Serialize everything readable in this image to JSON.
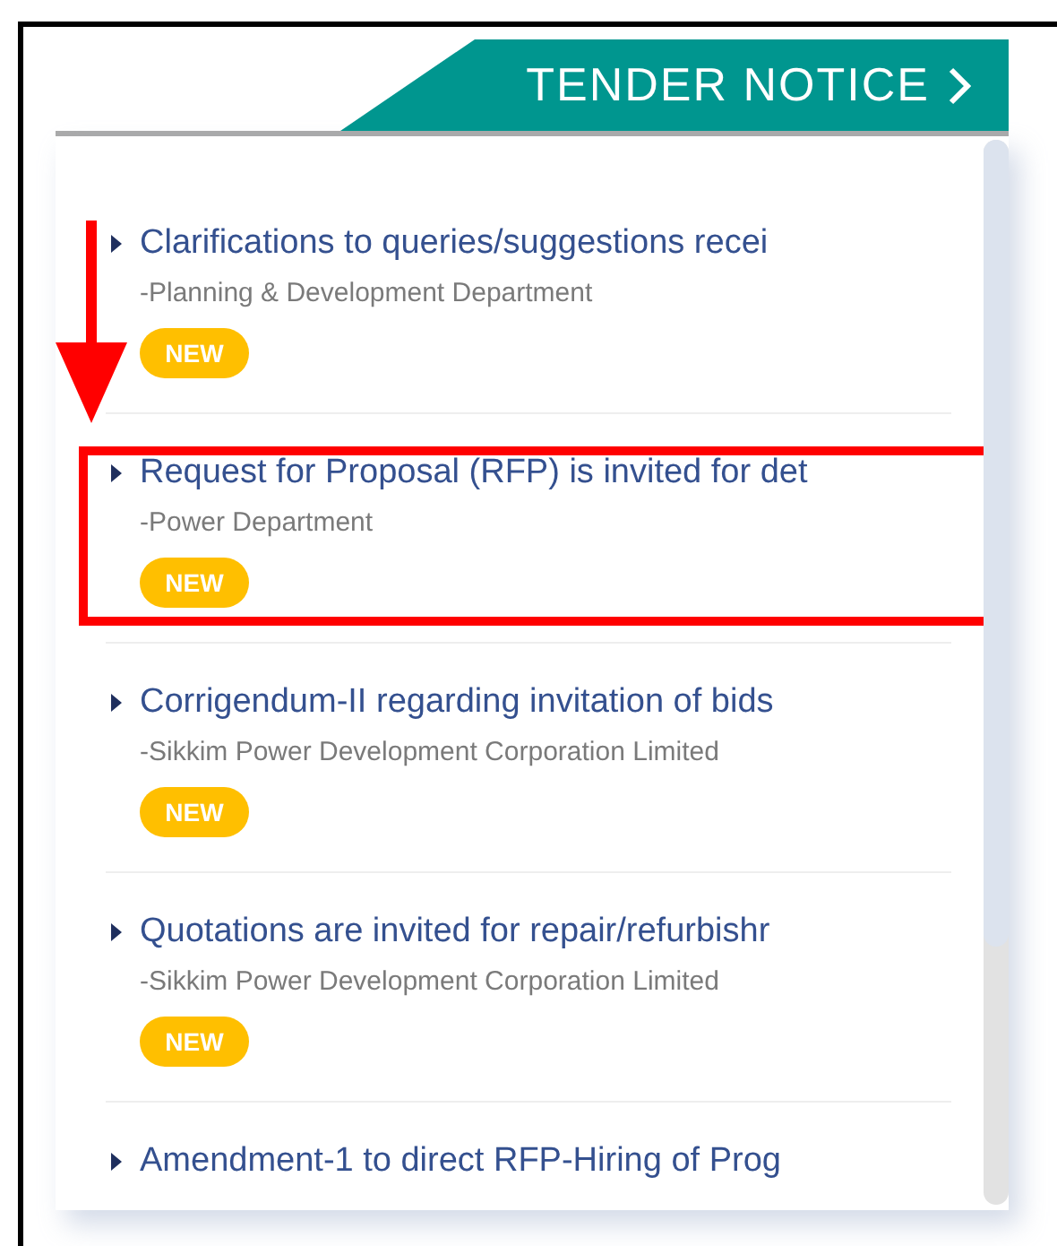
{
  "header": {
    "title": "TENDER NOTICE"
  },
  "notices": [
    {
      "title": "Clarifications to queries/suggestions recei",
      "department": "-Planning & Development Department",
      "badge": "NEW",
      "highlighted": false
    },
    {
      "title": "Request for Proposal (RFP) is invited for det",
      "department": "-Power Department",
      "badge": "NEW",
      "highlighted": true
    },
    {
      "title": "Corrigendum-II regarding invitation of bids",
      "department": "-Sikkim Power Development Corporation Limited",
      "badge": "NEW",
      "highlighted": false
    },
    {
      "title": "Quotations are invited for repair/refurbishr",
      "department": "-Sikkim Power Development Corporation Limited",
      "badge": "NEW",
      "highlighted": false
    },
    {
      "title": "Amendment-1 to direct RFP-Hiring of Prog",
      "highlighted": false
    }
  ]
}
